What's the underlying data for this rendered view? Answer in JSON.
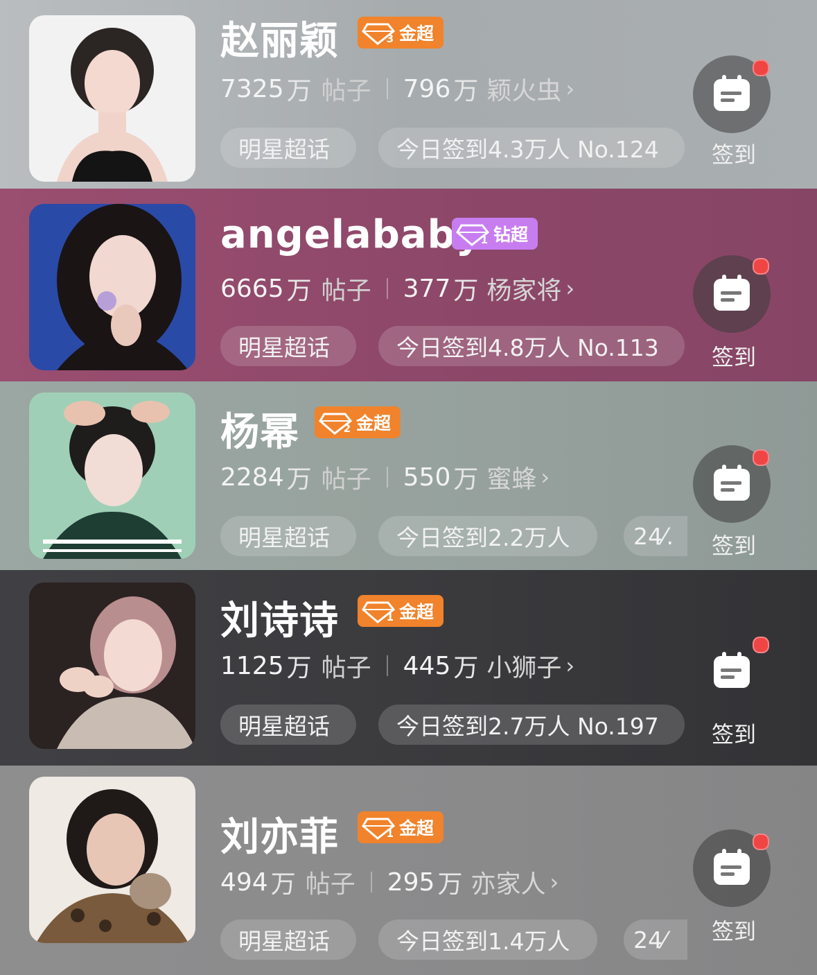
{
  "cards": [
    {
      "name": "赵丽颖",
      "badge": {
        "type": "gold",
        "level": "3",
        "text": "金超"
      },
      "posts": {
        "num": "7325",
        "unit": "万",
        "label": "帖子"
      },
      "fans": {
        "num": "796",
        "unit": "万",
        "label": "颖火虫"
      },
      "category": "明星超话",
      "daily": "今日签到4.3万人 No.124",
      "extra": "",
      "checkin_label": "签到",
      "bg": "#a6acaf"
    },
    {
      "name": "angelababy",
      "badge": {
        "type": "diamond",
        "level": "1",
        "text": "钻超"
      },
      "posts": {
        "num": "6665",
        "unit": "万",
        "label": "帖子"
      },
      "fans": {
        "num": "377",
        "unit": "万",
        "label": "杨家将"
      },
      "category": "明星超话",
      "daily": "今日签到4.8万人 No.113",
      "extra": "",
      "checkin_label": "签到",
      "bg": "#8f4a6b"
    },
    {
      "name": "杨幂",
      "badge": {
        "type": "gold",
        "level": "2",
        "text": "金超"
      },
      "posts": {
        "num": "2284",
        "unit": "万",
        "label": "帖子"
      },
      "fans": {
        "num": "550",
        "unit": "万",
        "label": "蜜蜂"
      },
      "category": "明星超话",
      "daily": "今日签到2.2万人",
      "extra": "24⁄.",
      "checkin_label": "签到",
      "bg": "#94a09c"
    },
    {
      "name": "刘诗诗",
      "badge": {
        "type": "gold",
        "level": "1",
        "text": "金超"
      },
      "posts": {
        "num": "1125",
        "unit": "万",
        "label": "帖子"
      },
      "fans": {
        "num": "445",
        "unit": "万",
        "label": "小狮子"
      },
      "category": "明星超话",
      "daily": "今日签到2.7万人 No.197",
      "extra": "",
      "checkin_label": "签到",
      "bg": "#3f3f42"
    },
    {
      "name": "刘亦菲",
      "badge": {
        "type": "gold",
        "level": "1",
        "text": "金超"
      },
      "posts": {
        "num": "494",
        "unit": "万",
        "label": "帖子"
      },
      "fans": {
        "num": "295",
        "unit": "万",
        "label": "亦家人"
      },
      "category": "明星超话",
      "daily": "今日签到1.4万人",
      "extra": "24⁄",
      "checkin_label": "签到",
      "bg": "#8a8a8b"
    }
  ]
}
